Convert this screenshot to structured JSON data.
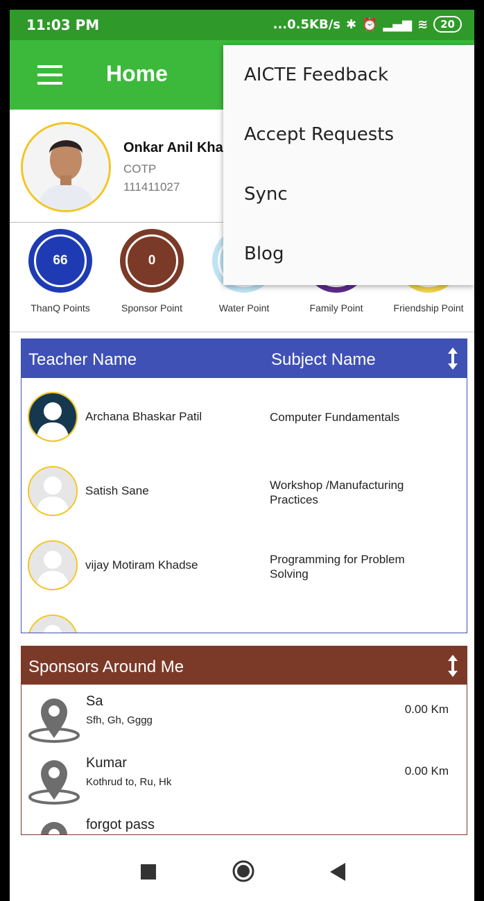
{
  "status_bar": {
    "time": "11:03 PM",
    "net_speed": "...0.5KB/s",
    "battery": "20"
  },
  "app_bar": {
    "title": "Home"
  },
  "profile": {
    "name": "Onkar Anil Kha",
    "department": "COTP",
    "id": "111411027"
  },
  "points": [
    {
      "label": "ThanQ Points",
      "value": "66",
      "color": "#1f3bb3"
    },
    {
      "label": "Sponsor Point",
      "value": "0",
      "color": "#7b3a28"
    },
    {
      "label": "Water Point",
      "value": "",
      "color": "#bfe3f3"
    },
    {
      "label": "Family Point",
      "value": "",
      "color": "#5d2a8a"
    },
    {
      "label": "Friendship Point",
      "value": "",
      "color": "#f0d24a"
    }
  ],
  "teachers": {
    "header_name": "Teacher Name",
    "header_subject": "Subject Name",
    "rows": [
      {
        "name": "Archana Bhaskar Patil",
        "subject": "Computer Fundamentals"
      },
      {
        "name": "Satish Sane",
        "subject": "Workshop /Manufacturing Practices"
      },
      {
        "name": "vijay Motiram Khadse",
        "subject": "Programming for Problem Solving"
      }
    ]
  },
  "sponsors": {
    "header": "Sponsors Around Me",
    "rows": [
      {
        "name": "Sa",
        "address": "Sfh, Gh, Gggg",
        "distance": "0.00 Km"
      },
      {
        "name": "Kumar",
        "address": "Kothrud to, Ru, Hk",
        "distance": "0.00 Km"
      },
      {
        "name": "forgot pass",
        "address": "",
        "distance": ""
      }
    ]
  },
  "menu": {
    "items": [
      "AICTE Feedback",
      "Accept Requests",
      "Sync",
      "Blog"
    ]
  },
  "colors": {
    "status_bar": "#2f9a2a",
    "app_bar": "#3cb93a",
    "teacher_header": "#3f51b5",
    "sponsor_header": "#7b3a28",
    "avatar_ring": "#f3c520"
  }
}
